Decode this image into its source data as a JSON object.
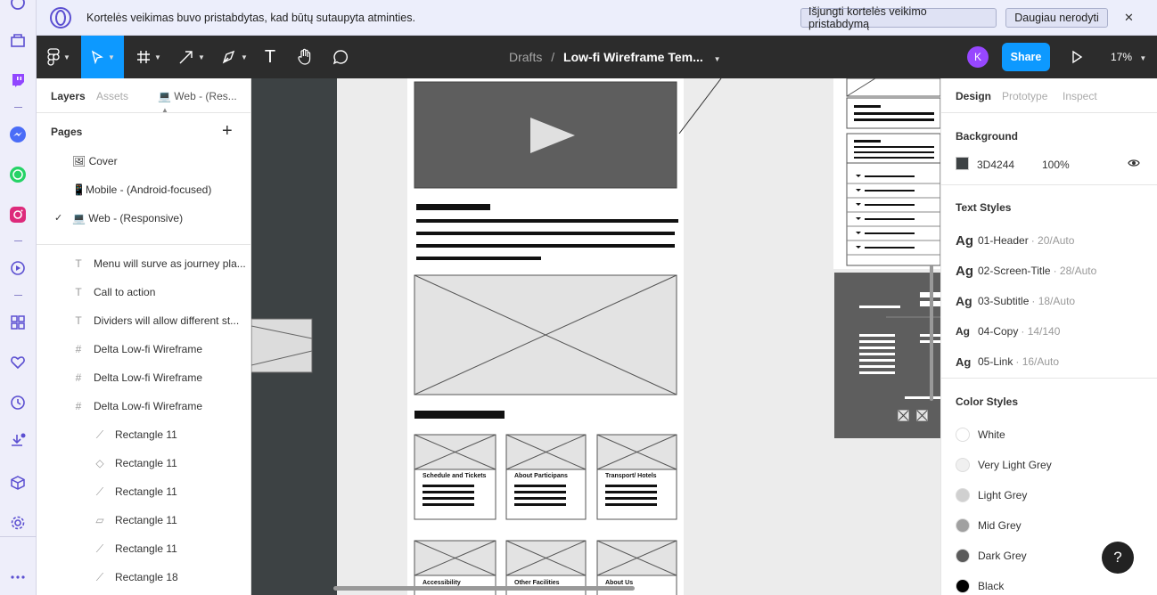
{
  "browser": {
    "notification": {
      "message": "Kortelės veikimas buvo pristabdytas, kad būtų sutaupyta atminties.",
      "disable_button": "Išjungti kortelės veikimo pristabdymą",
      "dismiss_button": "Daugiau nerodyti",
      "close_glyph": "✕"
    },
    "sidebar_icons": [
      "history-icon",
      "crypto-wallet-icon",
      "twitch-icon",
      "messenger-icon",
      "whatsapp-icon",
      "instagram-icon",
      "player-icon",
      "speed-dial-icon",
      "heart-icon",
      "clock-icon",
      "downloads-icon",
      "cube-icon",
      "settings-icon",
      "more-icon"
    ]
  },
  "toolbar": {
    "breadcrumb_drafts": "Drafts",
    "breadcrumb_sep": "/",
    "file_name": "Low-fi Wireframe Tem...",
    "avatar_initial": "K",
    "share_label": "Share",
    "zoom": "17%",
    "text_tool_glyph": "T"
  },
  "left_panel": {
    "tab_layers": "Layers",
    "tab_assets": "Assets",
    "current_page_short": "Web - (Res...",
    "pages_title": "Pages",
    "add_glyph": "+",
    "pages": [
      {
        "label": "🖼 Cover",
        "selected": false
      },
      {
        "label": "📱Mobile - (Android-focused)",
        "selected": false
      },
      {
        "label": "💻 Web - (Responsive)",
        "selected": true
      }
    ],
    "checkmark": "✓",
    "layers": [
      {
        "icon": "T",
        "label": "Menu will surve as journey pla...",
        "indent": 0
      },
      {
        "icon": "T",
        "label": "Call to action",
        "indent": 0
      },
      {
        "icon": "T",
        "label": "Dividers will allow different st...",
        "indent": 0
      },
      {
        "icon": "#",
        "label": "Delta Low-fi Wireframe",
        "indent": 0
      },
      {
        "icon": "#",
        "label": "Delta Low-fi Wireframe",
        "indent": 0
      },
      {
        "icon": "#",
        "label": "Delta Low-fi Wireframe",
        "indent": 0
      },
      {
        "icon": "⟋",
        "label": "Rectangle 11",
        "indent": 1
      },
      {
        "icon": "◇",
        "label": "Rectangle 11",
        "indent": 1
      },
      {
        "icon": "⟋",
        "label": "Rectangle 11",
        "indent": 1
      },
      {
        "icon": "▱",
        "label": "Rectangle 11",
        "indent": 1
      },
      {
        "icon": "⟋",
        "label": "Rectangle 11",
        "indent": 1
      },
      {
        "icon": "⟋",
        "label": "Rectangle 18",
        "indent": 1
      }
    ]
  },
  "canvas": {
    "cards_row1": [
      "Schedule and Tickets",
      "About Participans",
      "Transport/ Hotels"
    ],
    "cards_row2": [
      "Accessibility",
      "Other Facilities",
      "About Us"
    ]
  },
  "right_panel": {
    "tab_design": "Design",
    "tab_prototype": "Prototype",
    "tab_inspect": "Inspect",
    "background_title": "Background",
    "background_hex": "3D4244",
    "background_opacity": "100%",
    "background_color": "#3D4244",
    "text_styles_title": "Text Styles",
    "ag_glyph": "Ag",
    "text_styles": [
      {
        "name": "01-Header",
        "meta": "· 20/Auto"
      },
      {
        "name": "02-Screen-Title",
        "meta": "· 28/Auto"
      },
      {
        "name": "03-Subtitle",
        "meta": "· 18/Auto"
      },
      {
        "name": "04-Copy",
        "meta": "· 14/140"
      },
      {
        "name": "05-Link",
        "meta": "· 16/Auto"
      }
    ],
    "color_styles_title": "Color Styles",
    "color_styles": [
      {
        "name": "White",
        "color": "#ffffff"
      },
      {
        "name": "Very Light Grey",
        "color": "#f0f0f0"
      },
      {
        "name": "Light Grey",
        "color": "#d0d0d0"
      },
      {
        "name": "Mid Grey",
        "color": "#a0a0a0"
      },
      {
        "name": "Dark Grey",
        "color": "#5a5a5a"
      },
      {
        "name": "Black",
        "color": "#000000"
      }
    ],
    "help_glyph": "?"
  }
}
